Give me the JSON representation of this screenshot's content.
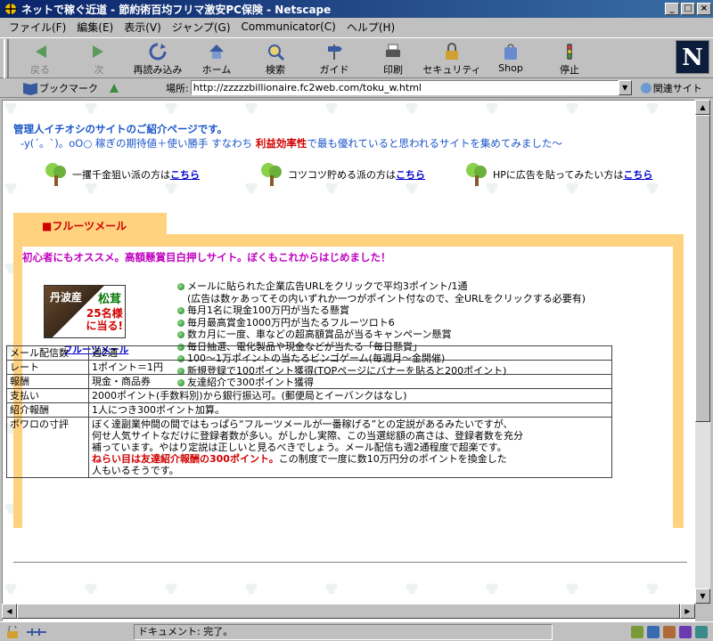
{
  "window": {
    "title": "ネットで稼ぐ近道 - 節約術百均フリマ激安PC保険 - Netscape"
  },
  "menu": [
    "ファイル(F)",
    "編集(E)",
    "表示(V)",
    "ジャンプ(G)",
    "Communicator(C)",
    "ヘルプ(H)"
  ],
  "toolbar": [
    {
      "label": "戻る",
      "icon": "back-arrow-icon",
      "enabled": false
    },
    {
      "label": "次",
      "icon": "forward-arrow-icon",
      "enabled": false
    },
    {
      "label": "再読み込み",
      "icon": "reload-icon",
      "enabled": true
    },
    {
      "label": "ホーム",
      "icon": "home-icon",
      "enabled": true
    },
    {
      "label": "検索",
      "icon": "search-icon",
      "enabled": true
    },
    {
      "label": "ガイド",
      "icon": "guide-icon",
      "enabled": true
    },
    {
      "label": "印刷",
      "icon": "print-icon",
      "enabled": true
    },
    {
      "label": "セキュリティ",
      "icon": "lock-icon",
      "enabled": true
    },
    {
      "label": "Shop",
      "icon": "shop-icon",
      "enabled": true
    },
    {
      "label": "停止",
      "icon": "stop-icon",
      "enabled": true
    }
  ],
  "brand": {
    "logo": "N"
  },
  "location": {
    "bookmarks_label": "ブックマーク",
    "location_label": "場所:",
    "url": "http://zzzzzbillionaire.fc2web.com/toku_w.html",
    "related_label": "関連サイト"
  },
  "page": {
    "intro_line1": "管理人イチオシのサイトのご紹介ページです。",
    "intro_line2_prefix": "-y(´。`)。oO○ 稼ぎの期待値＋使い勝手 すなわち ",
    "intro_line2_red": "利益効率性",
    "intro_line2_suffix": "で最も優れていると思われるサイトを集めてみました～",
    "links": [
      {
        "text": "一攫千金狙い派の方は",
        "link": "こちら"
      },
      {
        "text": "コツコツ貯める派の方は",
        "link": "こちら"
      },
      {
        "text": "HPに広告を貼ってみたい方は",
        "link": "こちら"
      }
    ],
    "section_tab": "■フルーツメール",
    "headline": "初心者にもオススメ。高額懸賞目白押しサイト。ぼくもこれからはじめました！",
    "banner": {
      "line1": "丹波産",
      "line2": "松茸",
      "line3": "25名様",
      "line4": "に当る!",
      "caption": "フルーツメール"
    },
    "features": [
      {
        "text": "メールに貼られた企業広告URLをクリックで平均3ポイント/1通",
        "bullet": true
      },
      {
        "text": "(広告は数ヶあってその内いずれか一つがポイント付なので、全URLをクリックする必要有)",
        "bullet": false
      },
      {
        "text": "毎月1名に現金100万円が当たる懸賞",
        "bullet": true
      },
      {
        "text": "毎月最高賞金1000万円が当たるフルーツロト6",
        "bullet": true
      },
      {
        "text": "数カ月に一度、車などの超高額賞品が当るキャンペーン懸賞",
        "bullet": true
      },
      {
        "text": "毎日抽選、電化製品や現金などが当たる「毎日懸賞」",
        "bullet": true
      },
      {
        "text": "100～1万ポイントの当たるビンゴゲーム(毎週月～金開催)",
        "bullet": true
      },
      {
        "text": "新規登録で100ポイント獲得(TOPページにバナーを貼ると200ポイント)",
        "bullet": true
      },
      {
        "text": "友達紹介で300ポイント獲得",
        "bullet": true
      }
    ],
    "info_rows": [
      {
        "key": "メール配信数",
        "value": "週2通"
      },
      {
        "key": "レート",
        "value": "1ポイント＝1円"
      },
      {
        "key": "報酬",
        "value": "現金・商品券"
      },
      {
        "key": "支払い",
        "value": "2000ポイント(手数料別)から銀行振込可。(郵便局とイーバンクはなし)"
      },
      {
        "key": "紹介報酬",
        "value": "1人につき300ポイント加算。"
      }
    ],
    "review_key": "ボワロの寸評",
    "review_lines": [
      "ぼく達副業仲間の間ではもっぱら“フルーツメールが一番稼げる”との定説があるみたいですが、",
      "何せ人気サイトなだけに登録者数が多い。がしかし実際、この当選総額の高さは、登録者数を充分",
      "補っています。やはり定説は正しいと見るべきでしょう。メール配信も週2通程度で超楽です。"
    ],
    "review_red": "ねらい目は友達紹介報酬の300ポイント。",
    "review_tail": "この制度で一度に数10万円分のポイントを換金した",
    "review_last": "人もいるそうです。"
  },
  "statusbar": {
    "text": "ドキュメント: 完了。"
  },
  "colors": {
    "accent_blue": "#1a56c8",
    "red": "#d00000",
    "panel": "#ffd27f",
    "headline": "#c000c0"
  }
}
